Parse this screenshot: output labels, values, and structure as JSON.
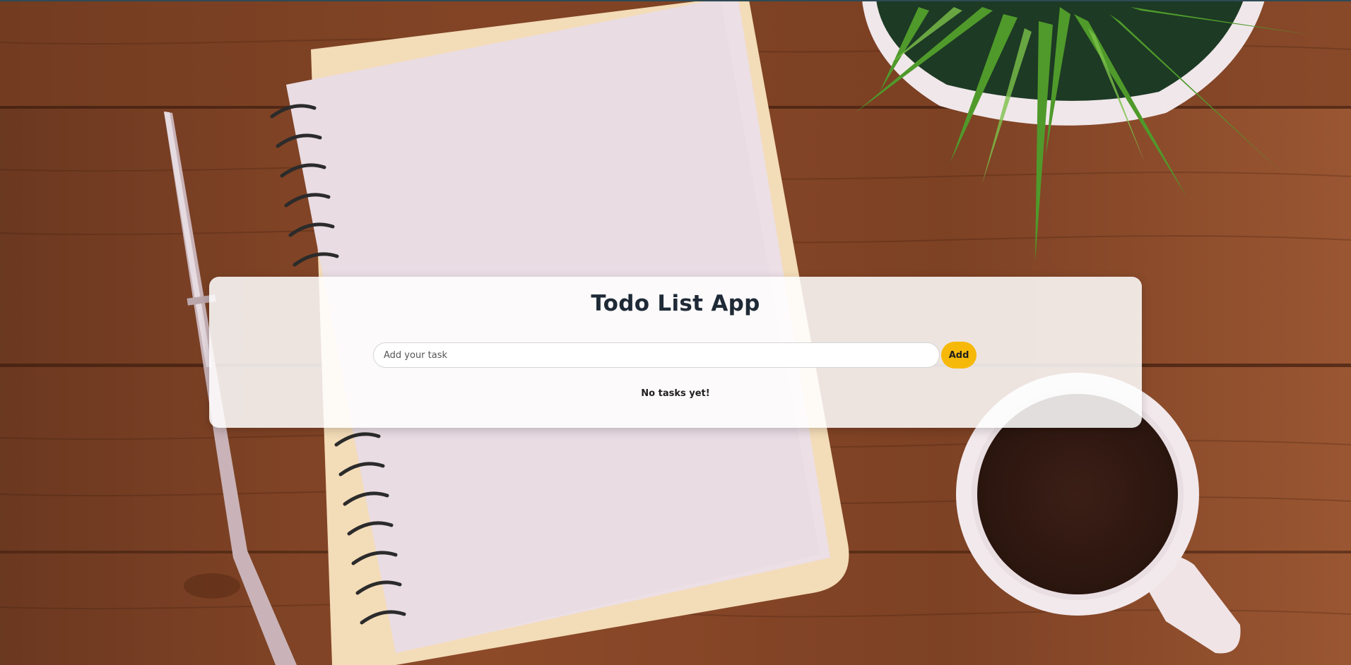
{
  "app": {
    "title": "Todo List App"
  },
  "task_form": {
    "input_value": "",
    "input_placeholder": "Add your task",
    "add_label": "Add"
  },
  "task_list": {
    "items": [],
    "empty_message": "No tasks yet!"
  },
  "colors": {
    "accent": "#f6b90a",
    "card_background": "#ffffff",
    "title_text": "#1f2a37"
  },
  "background": {
    "scene_objects": [
      "wooden-desk",
      "spiral-notebook",
      "pen",
      "potted-plant",
      "coffee-cup"
    ]
  }
}
